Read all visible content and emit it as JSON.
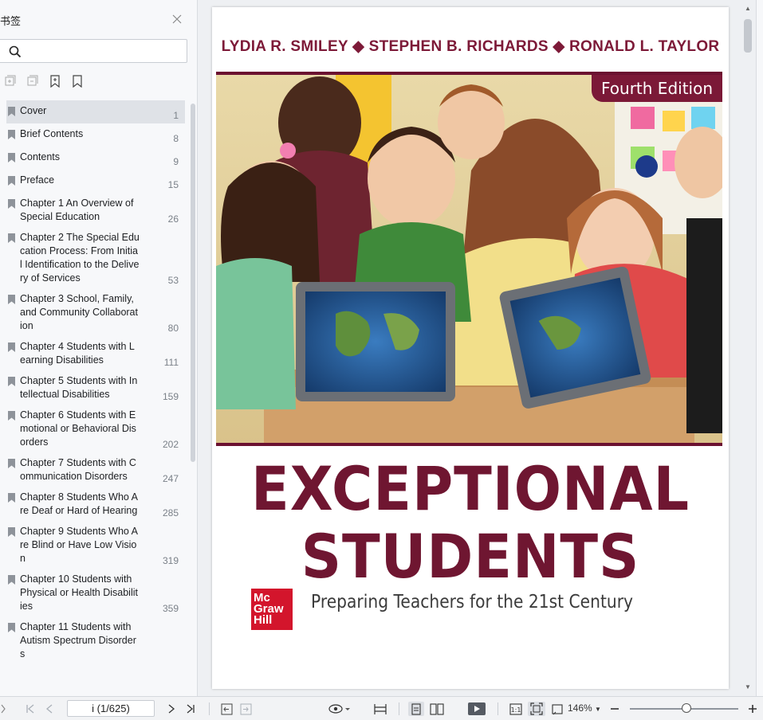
{
  "sidebar": {
    "title": "书签",
    "search_placeholder": "",
    "bookmarks": [
      {
        "label": "Cover",
        "page": "1",
        "selected": true
      },
      {
        "label": "Brief Contents",
        "page": "8"
      },
      {
        "label": "Contents",
        "page": "9"
      },
      {
        "label": "Preface",
        "page": "15"
      },
      {
        "label": "Chapter 1 An Overview of Special Education",
        "page": "26"
      },
      {
        "label": "Chapter 2 The Special Education Process: From Initial Identification to the Delivery of Services",
        "page": "53"
      },
      {
        "label": "Chapter 3 School, Family, and Community Collaboration",
        "page": "80"
      },
      {
        "label": "Chapter 4 Students with Learning Disabilities",
        "page": "111"
      },
      {
        "label": "Chapter 5 Students with Intellectual Disabilities",
        "page": "159"
      },
      {
        "label": "Chapter 6 Students with Emotional or Behavioral Disorders",
        "page": "202"
      },
      {
        "label": "Chapter 7 Students with Communication Disorders",
        "page": "247"
      },
      {
        "label": "Chapter 8 Students Who Are Deaf or Hard of Hearing",
        "page": "285"
      },
      {
        "label": "Chapter 9 Students Who Are Blind or Have Low Vision",
        "page": "319"
      },
      {
        "label": "Chapter 10 Students with Physical or Health Disabilities",
        "page": "359"
      },
      {
        "label": "Chapter 11 Students with Autism Spectrum Disorders",
        "page": ""
      }
    ]
  },
  "cover": {
    "authors": "LYDIA R. SMILEY ◆ STEPHEN B. RICHARDS ◆ RONALD L. TAYLOR",
    "edition": "Fourth Edition",
    "title_line1": "EXCEPTIONAL",
    "title_line2": "STUDENTS",
    "subtitle": "Preparing Teachers for the 21st Century",
    "publisher_logo": "Mc Graw Hill"
  },
  "toolbar": {
    "page_value": "i (1/625)",
    "zoom": "146%"
  },
  "colors": {
    "accent": "#7b1937",
    "title": "#6f1631",
    "logo": "#d3152c"
  }
}
